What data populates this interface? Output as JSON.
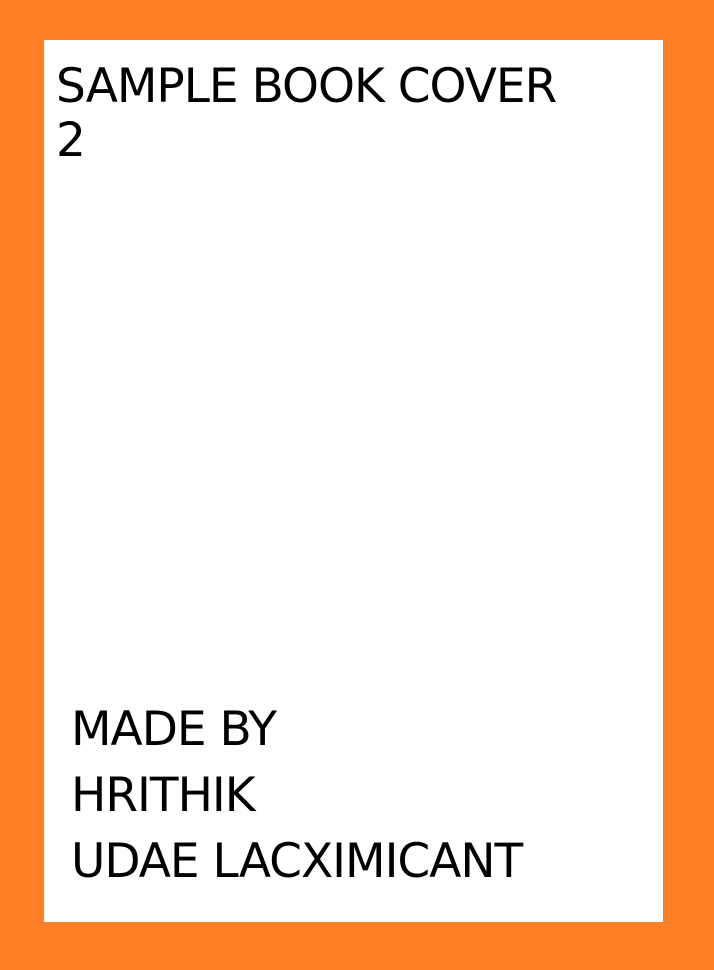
{
  "cover": {
    "title_line1": "SAMPLE BOOK COVER",
    "title_line2": "2",
    "credit_line1": "MADE BY",
    "credit_line2": "HRITHIK",
    "credit_line3": "UDAE LACXIMICANT"
  },
  "colors": {
    "border": "#FF7F27",
    "panel": "#FFFFFF",
    "text": "#000000"
  }
}
